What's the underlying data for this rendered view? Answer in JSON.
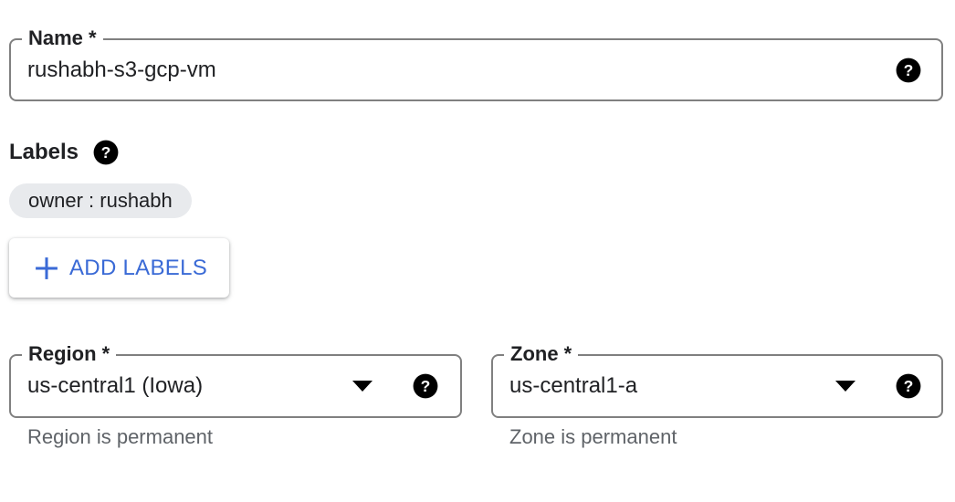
{
  "name_field": {
    "label": "Name *",
    "value": "rushabh-s3-gcp-vm",
    "help_icon": "help-icon"
  },
  "labels": {
    "title": "Labels",
    "help_icon": "help-icon",
    "chips": [
      {
        "text": "owner : rushabh"
      }
    ],
    "add_button": {
      "label": "ADD LABELS",
      "icon": "plus-icon",
      "color": "#3a6ad6"
    }
  },
  "region": {
    "label": "Region *",
    "value": "us-central1 (Iowa)",
    "hint": "Region is permanent",
    "caret_icon": "chevron-down-icon",
    "help_icon": "help-icon"
  },
  "zone": {
    "label": "Zone *",
    "value": "us-central1-a",
    "hint": "Zone is permanent",
    "caret_icon": "chevron-down-icon",
    "help_icon": "help-icon"
  }
}
